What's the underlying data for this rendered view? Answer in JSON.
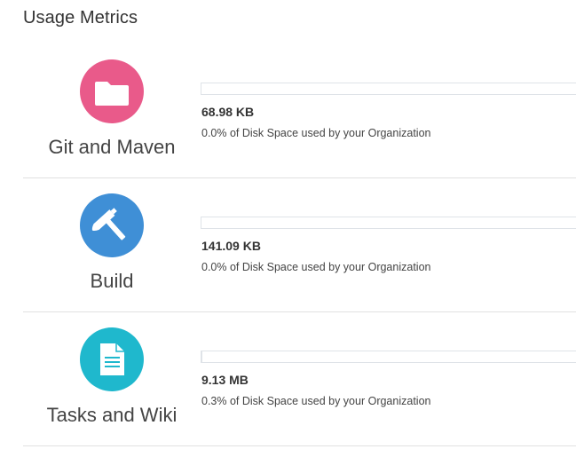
{
  "page": {
    "title": "Usage Metrics"
  },
  "metrics": [
    {
      "service": "Git and Maven",
      "icon": "folder-icon",
      "icon_color": "#e95a8a",
      "size": "68.98 KB",
      "percent": 0.0,
      "description": "0.0% of Disk Space used by your Organization"
    },
    {
      "service": "Build",
      "icon": "hammer-icon",
      "icon_color": "#3f8fd6",
      "size": "141.09 KB",
      "percent": 0.0,
      "description": "0.0% of Disk Space used by your Organization"
    },
    {
      "service": "Tasks and Wiki",
      "icon": "document-icon",
      "icon_color": "#1fb8cd",
      "size": "9.13 MB",
      "percent": 0.3,
      "description": "0.3% of Disk Space used by your Organization"
    }
  ]
}
